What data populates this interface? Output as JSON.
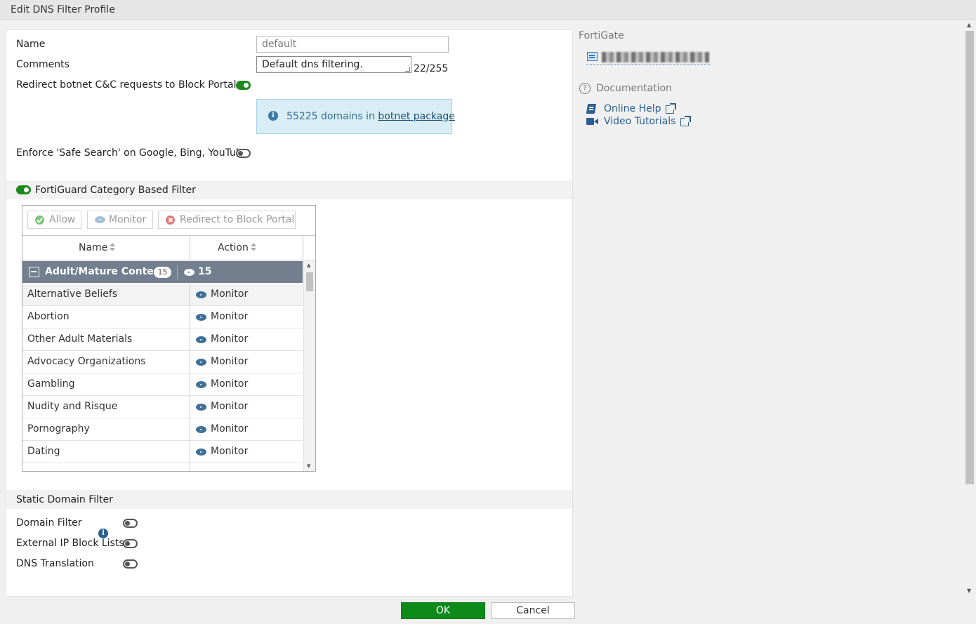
{
  "window": {
    "title": "Edit DNS Filter Profile"
  },
  "form": {
    "name_label": "Name",
    "name_value": "default",
    "comments_label": "Comments",
    "comments_value": "Default dns filtering.",
    "comments_counter": "22/255",
    "redirect_botnet_label": "Redirect botnet C&C requests to Block Portal",
    "redirect_botnet_enabled": true,
    "info_text": "55225 domains in",
    "info_link": "botnet package",
    "safe_search_label": "Enforce 'Safe Search' on Google, Bing, YouTube",
    "safe_search_enabled": false
  },
  "fortiguard": {
    "label": "FortiGuard Category Based Filter",
    "enabled": true,
    "toolbar": {
      "allow": "Allow",
      "monitor": "Monitor",
      "redirect": "Redirect to Block Portal"
    },
    "columns": {
      "name": "Name",
      "action": "Action"
    },
    "group": {
      "name": "Adult/Mature Content",
      "count_badge": "15",
      "monitor_count": "15"
    },
    "rows": [
      {
        "name": "Alternative Beliefs",
        "action": "Monitor"
      },
      {
        "name": "Abortion",
        "action": "Monitor"
      },
      {
        "name": "Other Adult Materials",
        "action": "Monitor"
      },
      {
        "name": "Advocacy Organizations",
        "action": "Monitor"
      },
      {
        "name": "Gambling",
        "action": "Monitor"
      },
      {
        "name": "Nudity and Risque",
        "action": "Monitor"
      },
      {
        "name": "Pornography",
        "action": "Monitor"
      },
      {
        "name": "Dating",
        "action": "Monitor"
      }
    ]
  },
  "static_domain": {
    "header": "Static Domain Filter",
    "domain_filter_label": "Domain Filter",
    "domain_filter_enabled": false,
    "external_ip_label": "External IP Block Lists",
    "external_ip_enabled": false,
    "dns_translation_label": "DNS Translation",
    "dns_translation_enabled": false
  },
  "sidebar": {
    "device_header": "FortiGate",
    "documentation_header": "Documentation",
    "online_help": "Online Help",
    "video_tutorials": "Video Tutorials"
  },
  "footer": {
    "ok": "OK",
    "cancel": "Cancel"
  },
  "colors": {
    "accent_green": "#0d8a1a",
    "group_row": "#717f8e",
    "link_blue": "#2b5f93"
  }
}
